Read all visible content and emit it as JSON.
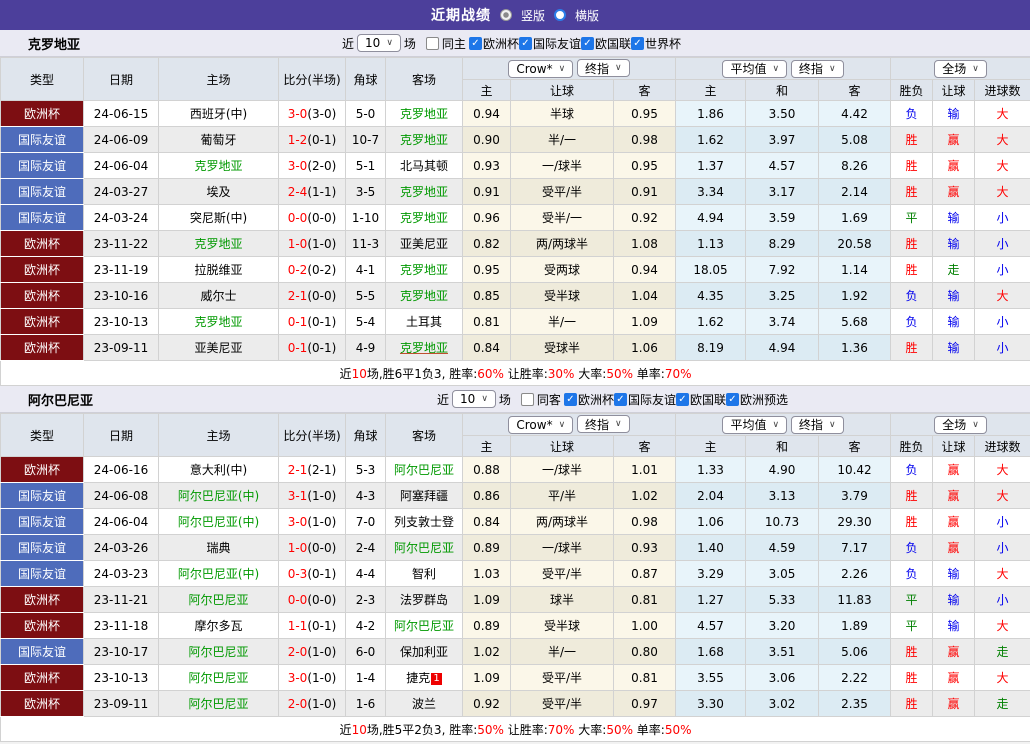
{
  "top_bar": {
    "title": "近期战绩",
    "radio_vertical": "竖版",
    "radio_horizontal": "横版"
  },
  "controls": {
    "recent_prefix": "近",
    "recent_count": "10",
    "recent_suffix": "场",
    "odds_source": "Crow*",
    "final1": "终指",
    "avg": "平均值",
    "final2": "终指",
    "scope": "全场"
  },
  "table_headers": {
    "type": "类型",
    "date": "日期",
    "home": "主场",
    "score": "比分(半场)",
    "corner": "角球",
    "away": "客场",
    "odds_home": "主",
    "odds_handicap": "让球",
    "odds_away": "客",
    "avg_home": "主",
    "avg_draw": "和",
    "avg_away": "客",
    "result_wl": "胜负",
    "result_handicap": "让球",
    "result_goals": "进球数"
  },
  "sections": [
    {
      "team": "克罗地亚",
      "filter": {
        "same_label": "同主",
        "same_checked": false,
        "leagues": [
          "欧洲杯",
          "国际友谊",
          "欧国联",
          "世界杯"
        ]
      },
      "rows": [
        {
          "league": "欧洲杯",
          "lc": "m",
          "date": "24-06-15",
          "home": "西班牙(中)",
          "hg": false,
          "score": "3-0",
          "half": "(3-0)",
          "corner": "5-0",
          "away": "克罗地亚",
          "ag": true,
          "oh": "0.94",
          "hcap": "半球",
          "oa": "0.95",
          "ah": "1.86",
          "ad": "3.50",
          "aa": "4.42",
          "r1": "负",
          "c1": "b",
          "r2": "输",
          "c2": "b",
          "r3": "大",
          "c3": "r"
        },
        {
          "league": "国际友谊",
          "lc": "b",
          "date": "24-06-09",
          "home": "葡萄牙",
          "hg": false,
          "score": "1-2",
          "half": "(0-1)",
          "corner": "10-7",
          "away": "克罗地亚",
          "ag": true,
          "oh": "0.90",
          "hcap": "半/一",
          "oa": "0.98",
          "ah": "1.62",
          "ad": "3.97",
          "aa": "5.08",
          "r1": "胜",
          "c1": "r",
          "r2": "赢",
          "c2": "r",
          "r3": "大",
          "c3": "r"
        },
        {
          "league": "国际友谊",
          "lc": "b",
          "date": "24-06-04",
          "home": "克罗地亚",
          "hg": true,
          "score": "3-0",
          "half": "(2-0)",
          "corner": "5-1",
          "away": "北马其顿",
          "ag": false,
          "oh": "0.93",
          "hcap": "一/球半",
          "oa": "0.95",
          "ah": "1.37",
          "ad": "4.57",
          "aa": "8.26",
          "r1": "胜",
          "c1": "r",
          "r2": "赢",
          "c2": "r",
          "r3": "大",
          "c3": "r"
        },
        {
          "league": "国际友谊",
          "lc": "b",
          "date": "24-03-27",
          "home": "埃及",
          "hg": false,
          "score": "2-4",
          "half": "(1-1)",
          "corner": "3-5",
          "away": "克罗地亚",
          "ag": true,
          "oh": "0.91",
          "hcap": "受平/半",
          "oa": "0.91",
          "ah": "3.34",
          "ad": "3.17",
          "aa": "2.14",
          "r1": "胜",
          "c1": "r",
          "r2": "赢",
          "c2": "r",
          "r3": "大",
          "c3": "r"
        },
        {
          "league": "国际友谊",
          "lc": "b",
          "date": "24-03-24",
          "home": "突尼斯(中)",
          "hg": false,
          "score": "0-0",
          "half": "(0-0)",
          "corner": "1-10",
          "away": "克罗地亚",
          "ag": true,
          "oh": "0.96",
          "hcap": "受半/一",
          "oa": "0.92",
          "ah": "4.94",
          "ad": "3.59",
          "aa": "1.69",
          "r1": "平",
          "c1": "g",
          "r2": "输",
          "c2": "b",
          "r3": "小",
          "c3": "b"
        },
        {
          "league": "欧洲杯",
          "lc": "m",
          "date": "23-11-22",
          "home": "克罗地亚",
          "hg": true,
          "score": "1-0",
          "half": "(1-0)",
          "corner": "11-3",
          "away": "亚美尼亚",
          "ag": false,
          "oh": "0.82",
          "hcap": "两/两球半",
          "oa": "1.08",
          "ah": "1.13",
          "ad": "8.29",
          "aa": "20.58",
          "r1": "胜",
          "c1": "r",
          "r2": "输",
          "c2": "b",
          "r3": "小",
          "c3": "b"
        },
        {
          "league": "欧洲杯",
          "lc": "m",
          "date": "23-11-19",
          "home": "拉脱维亚",
          "hg": false,
          "score": "0-2",
          "half": "(0-2)",
          "corner": "4-1",
          "away": "克罗地亚",
          "ag": true,
          "oh": "0.95",
          "hcap": "受两球",
          "oa": "0.94",
          "ah": "18.05",
          "ad": "7.92",
          "aa": "1.14",
          "r1": "胜",
          "c1": "r",
          "r2": "走",
          "c2": "g",
          "r3": "小",
          "c3": "b"
        },
        {
          "league": "欧洲杯",
          "lc": "m",
          "date": "23-10-16",
          "home": "威尔士",
          "hg": false,
          "score": "2-1",
          "half": "(0-0)",
          "corner": "5-5",
          "away": "克罗地亚",
          "ag": true,
          "oh": "0.85",
          "hcap": "受半球",
          "oa": "1.04",
          "ah": "4.35",
          "ad": "3.25",
          "aa": "1.92",
          "r1": "负",
          "c1": "b",
          "r2": "输",
          "c2": "b",
          "r3": "大",
          "c3": "r"
        },
        {
          "league": "欧洲杯",
          "lc": "m",
          "date": "23-10-13",
          "home": "克罗地亚",
          "hg": true,
          "score": "0-1",
          "half": "(0-1)",
          "corner": "5-4",
          "away": "土耳其",
          "ag": false,
          "oh": "0.81",
          "hcap": "半/一",
          "oa": "1.09",
          "ah": "1.62",
          "ad": "3.74",
          "aa": "5.68",
          "r1": "负",
          "c1": "b",
          "r2": "输",
          "c2": "b",
          "r3": "小",
          "c3": "b"
        },
        {
          "league": "欧洲杯",
          "lc": "m",
          "date": "23-09-11",
          "home": "亚美尼亚",
          "hg": false,
          "score": "0-1",
          "half": "(0-1)",
          "corner": "4-9",
          "away": "克罗地亚",
          "ag": true,
          "au": true,
          "oh": "0.84",
          "hcap": "受球半",
          "oa": "1.06",
          "ah": "8.19",
          "ad": "4.94",
          "aa": "1.36",
          "r1": "胜",
          "c1": "r",
          "r2": "输",
          "c2": "b",
          "r3": "小",
          "c3": "b"
        }
      ],
      "summary": [
        [
          "近",
          "k"
        ],
        [
          "10",
          "r"
        ],
        [
          "场,胜6平1负3, 胜率:",
          "k"
        ],
        [
          "60%",
          "r"
        ],
        [
          " 让胜率:",
          "k"
        ],
        [
          "30%",
          "r"
        ],
        [
          " 大率:",
          "k"
        ],
        [
          "50%",
          "r"
        ],
        [
          " 单率:",
          "k"
        ],
        [
          "70%",
          "r"
        ]
      ]
    },
    {
      "team": "阿尔巴尼亚",
      "filter": {
        "same_label": "同客",
        "same_checked": false,
        "leagues": [
          "欧洲杯",
          "国际友谊",
          "欧国联",
          "欧洲预选"
        ]
      },
      "rows": [
        {
          "league": "欧洲杯",
          "lc": "m",
          "date": "24-06-16",
          "home": "意大利(中)",
          "hg": false,
          "score": "2-1",
          "half": "(2-1)",
          "corner": "5-3",
          "away": "阿尔巴尼亚",
          "ag": true,
          "oh": "0.88",
          "hcap": "一/球半",
          "oa": "1.01",
          "ah": "1.33",
          "ad": "4.90",
          "aa": "10.42",
          "r1": "负",
          "c1": "b",
          "r2": "赢",
          "c2": "r",
          "r3": "大",
          "c3": "r"
        },
        {
          "league": "国际友谊",
          "lc": "b",
          "date": "24-06-08",
          "home": "阿尔巴尼亚(中)",
          "hg": true,
          "score": "3-1",
          "half": "(1-0)",
          "corner": "4-3",
          "away": "阿塞拜疆",
          "ag": false,
          "oh": "0.86",
          "hcap": "平/半",
          "oa": "1.02",
          "ah": "2.04",
          "ad": "3.13",
          "aa": "3.79",
          "r1": "胜",
          "c1": "r",
          "r2": "赢",
          "c2": "r",
          "r3": "大",
          "c3": "r"
        },
        {
          "league": "国际友谊",
          "lc": "b",
          "date": "24-06-04",
          "home": "阿尔巴尼亚(中)",
          "hg": true,
          "score": "3-0",
          "half": "(1-0)",
          "corner": "7-0",
          "away": "列支敦士登",
          "ag": false,
          "oh": "0.84",
          "hcap": "两/两球半",
          "oa": "0.98",
          "ah": "1.06",
          "ad": "10.73",
          "aa": "29.30",
          "r1": "胜",
          "c1": "r",
          "r2": "赢",
          "c2": "r",
          "r3": "小",
          "c3": "b"
        },
        {
          "league": "国际友谊",
          "lc": "b",
          "date": "24-03-26",
          "home": "瑞典",
          "hg": false,
          "score": "1-0",
          "half": "(0-0)",
          "corner": "2-4",
          "away": "阿尔巴尼亚",
          "ag": true,
          "oh": "0.89",
          "hcap": "一/球半",
          "oa": "0.93",
          "ah": "1.40",
          "ad": "4.59",
          "aa": "7.17",
          "r1": "负",
          "c1": "b",
          "r2": "赢",
          "c2": "r",
          "r3": "小",
          "c3": "b"
        },
        {
          "league": "国际友谊",
          "lc": "b",
          "date": "24-03-23",
          "home": "阿尔巴尼亚(中)",
          "hg": true,
          "score": "0-3",
          "half": "(0-1)",
          "corner": "4-4",
          "away": "智利",
          "ag": false,
          "oh": "1.03",
          "hcap": "受平/半",
          "oa": "0.87",
          "ah": "3.29",
          "ad": "3.05",
          "aa": "2.26",
          "r1": "负",
          "c1": "b",
          "r2": "输",
          "c2": "b",
          "r3": "大",
          "c3": "r"
        },
        {
          "league": "欧洲杯",
          "lc": "m",
          "date": "23-11-21",
          "home": "阿尔巴尼亚",
          "hg": true,
          "score": "0-0",
          "half": "(0-0)",
          "corner": "2-3",
          "away": "法罗群岛",
          "ag": false,
          "oh": "1.09",
          "hcap": "球半",
          "oa": "0.81",
          "ah": "1.27",
          "ad": "5.33",
          "aa": "11.83",
          "r1": "平",
          "c1": "g",
          "r2": "输",
          "c2": "b",
          "r3": "小",
          "c3": "b"
        },
        {
          "league": "欧洲杯",
          "lc": "m",
          "date": "23-11-18",
          "home": "摩尔多瓦",
          "hg": false,
          "score": "1-1",
          "half": "(0-1)",
          "corner": "4-2",
          "away": "阿尔巴尼亚",
          "ag": true,
          "oh": "0.89",
          "hcap": "受半球",
          "oa": "1.00",
          "ah": "4.57",
          "ad": "3.20",
          "aa": "1.89",
          "r1": "平",
          "c1": "g",
          "r2": "输",
          "c2": "b",
          "r3": "大",
          "c3": "r"
        },
        {
          "league": "国际友谊",
          "lc": "b",
          "date": "23-10-17",
          "home": "阿尔巴尼亚",
          "hg": true,
          "score": "2-0",
          "half": "(1-0)",
          "corner": "6-0",
          "away": "保加利亚",
          "ag": false,
          "oh": "1.02",
          "hcap": "半/一",
          "oa": "0.80",
          "ah": "1.68",
          "ad": "3.51",
          "aa": "5.06",
          "r1": "胜",
          "c1": "r",
          "r2": "赢",
          "c2": "r",
          "r3": "走",
          "c3": "g"
        },
        {
          "league": "欧洲杯",
          "lc": "m",
          "date": "23-10-13",
          "home": "阿尔巴尼亚",
          "hg": true,
          "score": "3-0",
          "half": "(1-0)",
          "corner": "1-4",
          "away": "捷克",
          "ag": false,
          "badge": "1",
          "oh": "1.09",
          "hcap": "受平/半",
          "oa": "0.81",
          "ah": "3.55",
          "ad": "3.06",
          "aa": "2.22",
          "r1": "胜",
          "c1": "r",
          "r2": "赢",
          "c2": "r",
          "r3": "大",
          "c3": "r"
        },
        {
          "league": "欧洲杯",
          "lc": "m",
          "date": "23-09-11",
          "home": "阿尔巴尼亚",
          "hg": true,
          "score": "2-0",
          "half": "(1-0)",
          "corner": "1-6",
          "away": "波兰",
          "ag": false,
          "oh": "0.92",
          "hcap": "受平/半",
          "oa": "0.97",
          "ah": "3.30",
          "ad": "3.02",
          "aa": "2.35",
          "r1": "胜",
          "c1": "r",
          "r2": "赢",
          "c2": "r",
          "r3": "走",
          "c3": "g"
        }
      ],
      "summary": [
        [
          "近",
          "k"
        ],
        [
          "10",
          "r"
        ],
        [
          "场,胜5平2负3, 胜率:",
          "k"
        ],
        [
          "50%",
          "r"
        ],
        [
          " 让胜率:",
          "k"
        ],
        [
          "70%",
          "r"
        ],
        [
          " 大率:",
          "k"
        ],
        [
          "50%",
          "r"
        ],
        [
          " 单率:",
          "k"
        ],
        [
          "50%",
          "r"
        ]
      ]
    }
  ]
}
